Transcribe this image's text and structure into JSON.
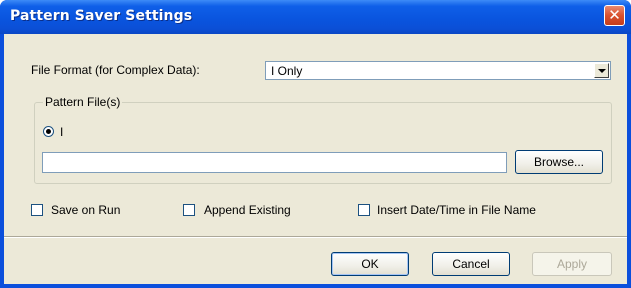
{
  "window": {
    "title": "Pattern Saver Settings",
    "close_glyph": "✕",
    "accent_color": "#0b4fdc",
    "face_color": "#ece9d8"
  },
  "format": {
    "label": "File Format (for Complex Data):",
    "selected": "I Only"
  },
  "pattern_files": {
    "legend": "Pattern File(s)",
    "radio_label": "I",
    "radio_checked": true,
    "path_value": "",
    "browse_label": "Browse..."
  },
  "options": {
    "save_on_run": {
      "label": "Save on Run",
      "checked": false
    },
    "append_existing": {
      "label": "Append Existing",
      "checked": false
    },
    "insert_datetime": {
      "label": "Insert Date/Time in File Name",
      "checked": false
    }
  },
  "buttons": {
    "ok": "OK",
    "cancel": "Cancel",
    "apply": "Apply"
  }
}
